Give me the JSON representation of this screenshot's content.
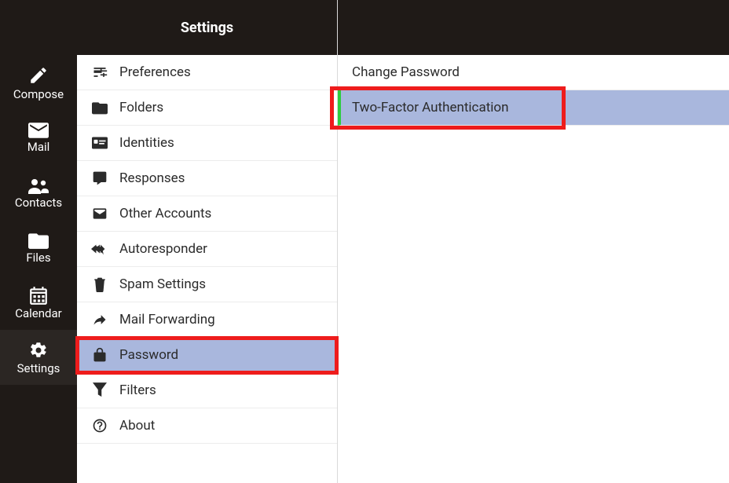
{
  "nav": {
    "compose": "Compose",
    "mail": "Mail",
    "contacts": "Contacts",
    "files": "Files",
    "calendar": "Calendar",
    "settings": "Settings"
  },
  "settings": {
    "title": "Settings",
    "items": {
      "preferences": "Preferences",
      "folders": "Folders",
      "identities": "Identities",
      "responses": "Responses",
      "other_accounts": "Other Accounts",
      "autoresponder": "Autoresponder",
      "spam_settings": "Spam Settings",
      "mail_forwarding": "Mail Forwarding",
      "password": "Password",
      "filters": "Filters",
      "about": "About"
    }
  },
  "password_sub": {
    "change_password": "Change Password",
    "two_factor": "Two-Factor Authentication"
  }
}
